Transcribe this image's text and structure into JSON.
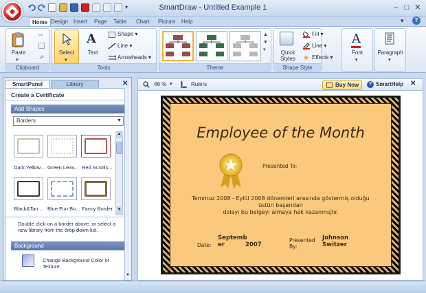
{
  "app": {
    "title": "SmartDraw - Untitled Example 1"
  },
  "tabs": [
    {
      "label": "Home"
    },
    {
      "label": "Design"
    },
    {
      "label": "Insert"
    },
    {
      "label": "Page"
    },
    {
      "label": "Table"
    },
    {
      "label": "Chart"
    },
    {
      "label": "Picture"
    },
    {
      "label": "Help"
    }
  ],
  "ribbon": {
    "clipboard": {
      "paste": "Paste",
      "label": "Clipboard"
    },
    "tools": {
      "select": "Select",
      "text": "Text",
      "shape": "Shape",
      "line": "Line",
      "arrowheads": "Arrowheads",
      "label": "Tools"
    },
    "theme": {
      "label": "Theme"
    },
    "shape_style": {
      "quick_styles": "Quick Styles",
      "fill": "Fill",
      "line": "Line",
      "effects": "Effects",
      "label": "Shape Style"
    },
    "font": {
      "label": "Font"
    },
    "paragraph": {
      "label": "Paragraph"
    }
  },
  "panel": {
    "tabs": [
      "SmartPanel",
      "Library"
    ],
    "heading": "Create a Certificate",
    "add_shapes": "Add Shapes",
    "dropdown_value": "Borders",
    "thumbs": [
      {
        "label": "Dark Yellow...",
        "color": "#c8bfa8"
      },
      {
        "label": "Green Leav...",
        "color": "#d0d6d0"
      },
      {
        "label": "Red Scrolls...",
        "color": "#b85050"
      },
      {
        "label": "Black&Tan...",
        "color": "#3a3a3a"
      },
      {
        "label": "Blue Fun Bo...",
        "color": "#8aa0d8"
      },
      {
        "label": "Fancy Border",
        "color": "#7a6a40"
      }
    ],
    "help_text": "Double click on a border above, or select a new library from the drop down list.",
    "background_header": "Background",
    "background_link": "Change Background Color or Texture."
  },
  "canvasbar": {
    "zoom": "46 %",
    "rulers": "Rulers",
    "buy_now": "Buy Now",
    "smarthelp": "SmartHelp"
  },
  "certificate": {
    "title": "Employee of the Month",
    "presented_to": "Presented To:",
    "body_line1": "Temmuz 2008 - Eylül 2008 dönemleri arasında göstermiş olduğu",
    "body_line2": "üstün başarıdan",
    "body_line3": "dolayı bu belgeyi almaya hak kazanmıştır.",
    "date_label": "Date:",
    "date_value_line1": "Septemb",
    "date_value_line2": "er",
    "date_year": "2007",
    "presented_by_line1": "Presented",
    "presented_by_line2": "By:",
    "presenter_line1": "Johnson",
    "presenter_line2": "Switzer"
  },
  "colors": {
    "accent": "#d42020",
    "certificate_fill": "#fbc97e",
    "ribbon_blue": "#c9d9ef"
  }
}
